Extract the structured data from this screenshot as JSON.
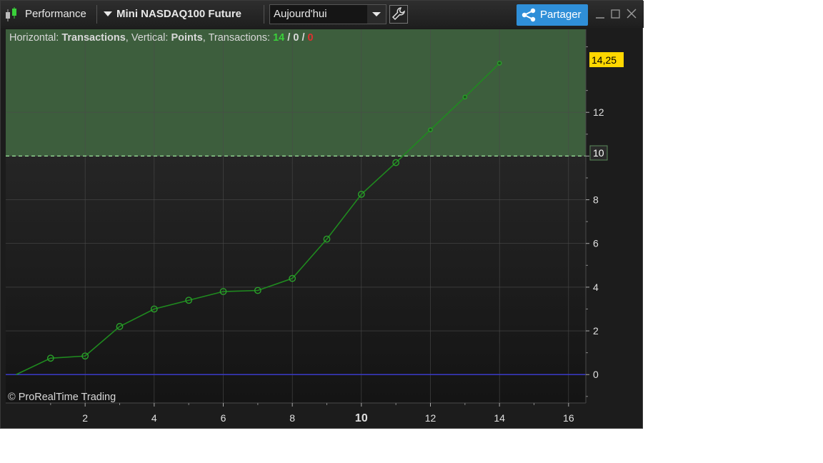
{
  "toolbar": {
    "title": "Performance",
    "instrument": "Mini NASDAQ100 Future",
    "period": "Aujourd'hui",
    "share_label": "Partager"
  },
  "chart": {
    "info_prefix_h": "Horizontal: ",
    "info_h_value": "Transactions",
    "info_prefix_v": ", Vertical: ",
    "info_v_value": "Points",
    "info_prefix_t": ", Transactions: ",
    "info_total": "14",
    "info_sep1": " / ",
    "info_neutral": "0",
    "info_sep2": " / ",
    "info_losses": "0",
    "copyright": "© ProRealTime Trading",
    "last_value_label": "14,25",
    "target_label": "10"
  },
  "colors": {
    "positive": "#3ad13a",
    "negative": "#e03030",
    "line": "#1f8a1f",
    "zone": "#3d5e3d",
    "baseline": "#3a3ac8",
    "badge": "#ffd700",
    "share": "#2f8fd8"
  },
  "chart_data": {
    "type": "line",
    "x": [
      0,
      1,
      2,
      3,
      4,
      5,
      6,
      7,
      8,
      9,
      10,
      11,
      12,
      13,
      14
    ],
    "series": [
      {
        "values": [
          0,
          0.75,
          0.85,
          2.2,
          3.0,
          3.4,
          3.8,
          3.85,
          4.4,
          6.2,
          8.25,
          9.7,
          11.2,
          12.7,
          14.25
        ]
      }
    ],
    "xlim": [
      -0.3,
      16.5
    ],
    "ylim": [
      -1.3,
      15.8
    ],
    "x_ticks": [
      "2",
      "4",
      "6",
      "8",
      "10",
      "12",
      "14",
      "16"
    ],
    "y_ticks": [
      "0",
      "2",
      "4",
      "6",
      "8",
      "10",
      "12"
    ],
    "target_level": 10,
    "grid": true
  }
}
